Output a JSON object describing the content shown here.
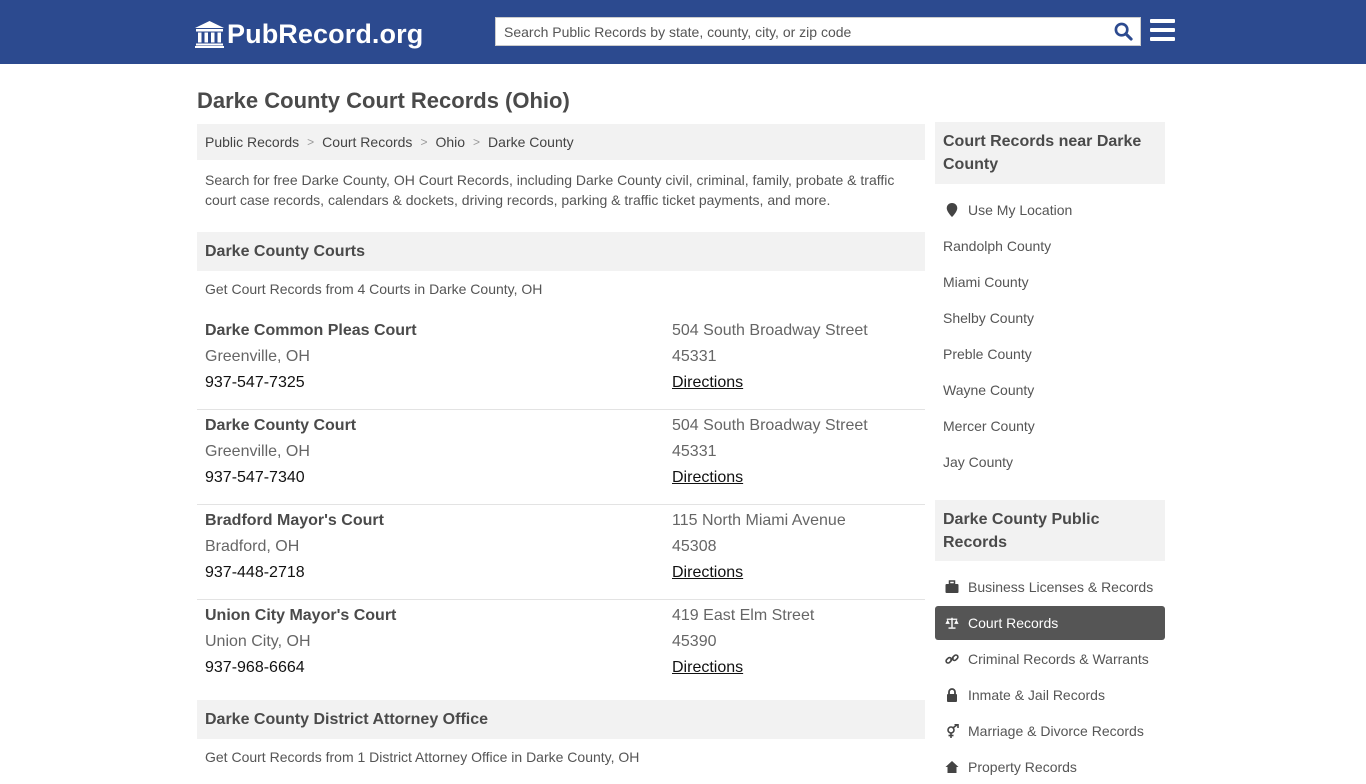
{
  "header": {
    "logo_text": "PubRecord.org",
    "search_placeholder": "Search Public Records by state, county, city, or zip code",
    "search_value": ""
  },
  "page": {
    "title": "Darke County Court Records (Ohio)",
    "breadcrumb": [
      "Public Records",
      "Court Records",
      "Ohio",
      "Darke County"
    ],
    "intro": "Search for free Darke County, OH Court Records, including Darke County civil, criminal, family, probate & traffic court case records, calendars & dockets, driving records, parking & traffic ticket payments, and more."
  },
  "courts_section": {
    "heading": "Darke County Courts",
    "subtitle": "Get Court Records from 4 Courts in Darke County, OH",
    "items": [
      {
        "name": "Darke Common Pleas Court",
        "city": "Greenville, OH",
        "phone": "937-547-7325",
        "address": "504 South Broadway Street",
        "zip": "45331",
        "directions": "Directions"
      },
      {
        "name": "Darke County Court",
        "city": "Greenville, OH",
        "phone": "937-547-7340",
        "address": "504 South Broadway Street",
        "zip": "45331",
        "directions": "Directions"
      },
      {
        "name": "Bradford Mayor's Court",
        "city": "Bradford, OH",
        "phone": "937-448-2718",
        "address": "115 North Miami Avenue",
        "zip": "45308",
        "directions": "Directions"
      },
      {
        "name": "Union City Mayor's Court",
        "city": "Union City, OH",
        "phone": "937-968-6664",
        "address": "419 East Elm Street",
        "zip": "45390",
        "directions": "Directions"
      }
    ]
  },
  "da_section": {
    "heading": "Darke County District Attorney Office",
    "subtitle": "Get Court Records from 1 District Attorney Office in Darke County, OH"
  },
  "sidebar": {
    "nearby_heading": "Court Records near Darke County",
    "use_location": "Use My Location",
    "nearby": [
      "Randolph County",
      "Miami County",
      "Shelby County",
      "Preble County",
      "Wayne County",
      "Mercer County",
      "Jay County"
    ],
    "public_heading": "Darke County Public Records",
    "public_items": [
      {
        "label": "Business Licenses & Records",
        "icon": "briefcase-icon",
        "active": false
      },
      {
        "label": "Court Records",
        "icon": "scale-icon",
        "active": true
      },
      {
        "label": "Criminal Records & Warrants",
        "icon": "link-icon",
        "active": false
      },
      {
        "label": "Inmate & Jail Records",
        "icon": "lock-icon",
        "active": false
      },
      {
        "label": "Marriage & Divorce Records",
        "icon": "gender-icon",
        "active": false
      },
      {
        "label": "Property Records",
        "icon": "home-icon",
        "active": false
      }
    ]
  }
}
